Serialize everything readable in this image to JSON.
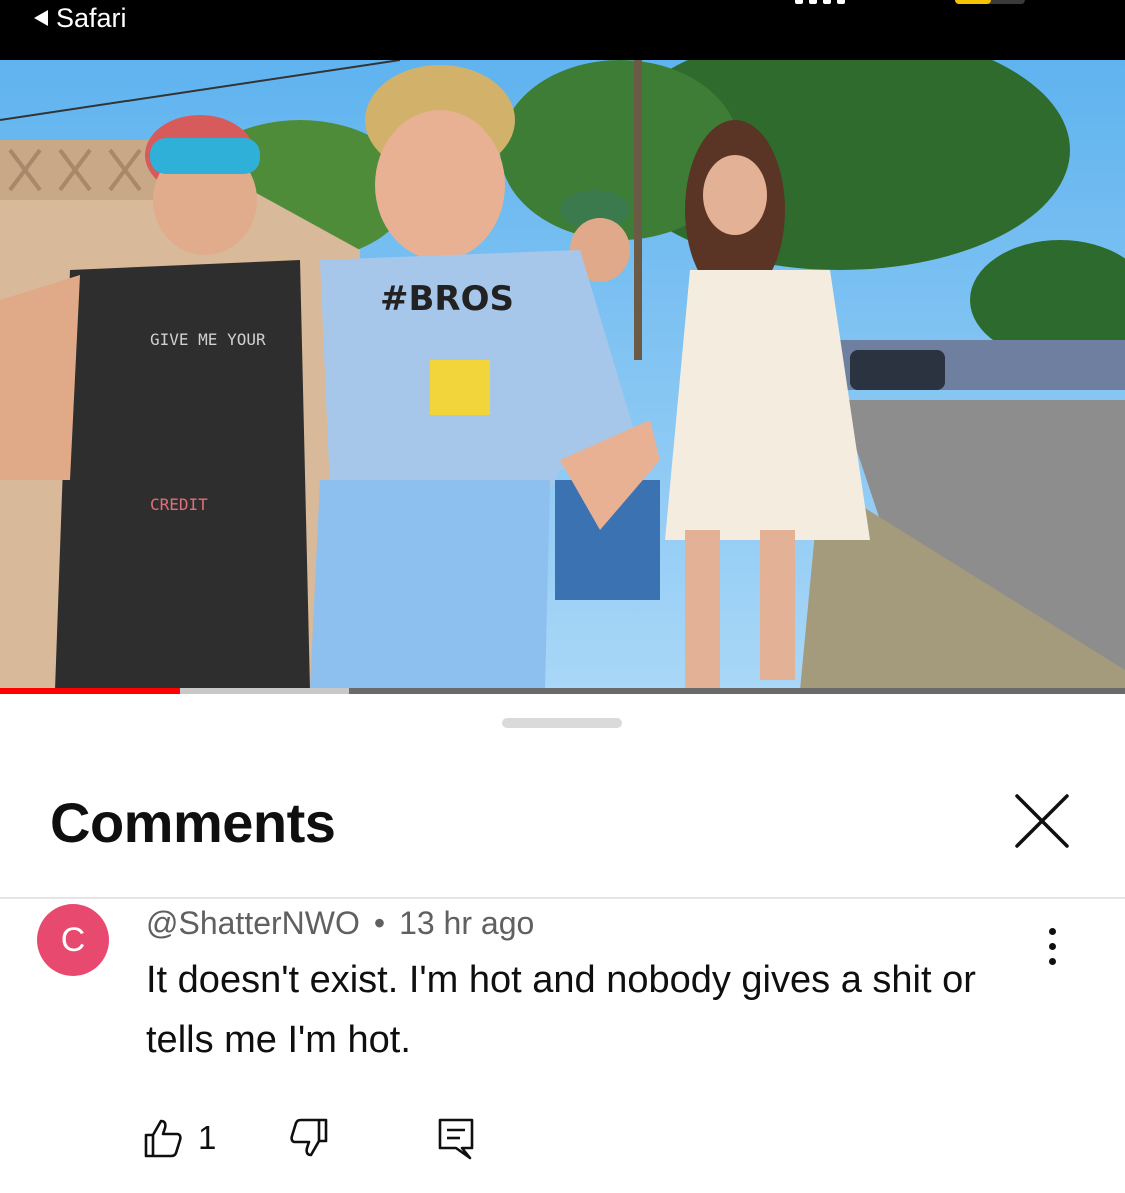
{
  "status_bar": {
    "back_label": "Safari"
  },
  "video": {
    "description_icon": "video-frame",
    "shirt_text": "#BROS",
    "tank_text_top": "GIVE ME YOUR",
    "tank_text_bottom": "CREDIT",
    "progress": {
      "played_fraction": 0.16,
      "buffered_fraction": 0.31,
      "played_color": "#ff0000"
    }
  },
  "comments_sheet": {
    "title": "Comments",
    "close_icon": "close-icon",
    "comment": {
      "avatar_initial": "C",
      "avatar_color": "#e84a6f",
      "author": "@ShatterNWO",
      "separator": "•",
      "time": "13 hr ago",
      "text": "It doesn't exist. I'm hot and nobody gives a shit or tells me I'm hot.",
      "like_count": "1",
      "icons": [
        "thumbs-up-icon",
        "thumbs-down-icon",
        "reply-icon",
        "more-vertical-icon"
      ]
    }
  }
}
